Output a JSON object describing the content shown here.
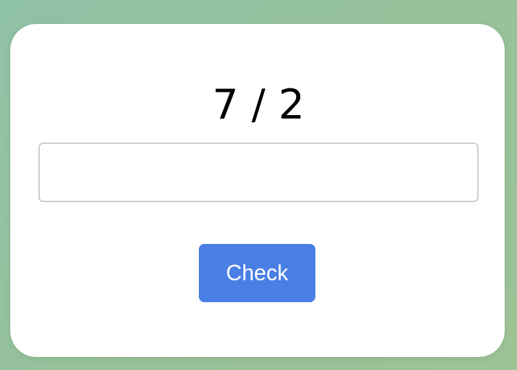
{
  "problem": {
    "text": "7 / 2"
  },
  "answer": {
    "value": "",
    "placeholder": ""
  },
  "actions": {
    "check_label": "Check"
  },
  "colors": {
    "button": "#4a7fe5",
    "card": "#ffffff",
    "input_border": "#cccccc"
  }
}
